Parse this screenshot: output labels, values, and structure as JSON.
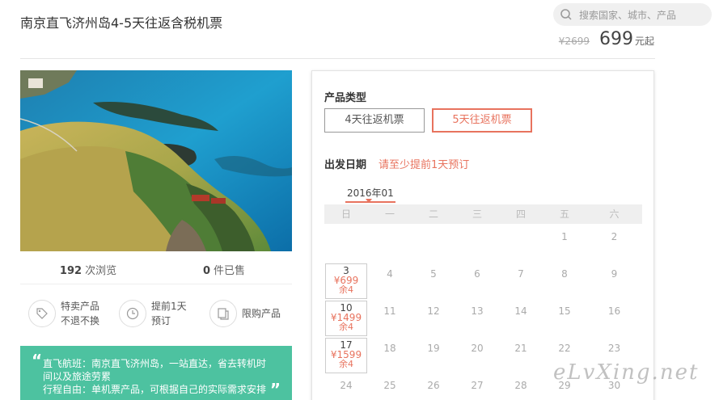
{
  "header": {
    "title": "南京直飞济州岛4-5天往返含税机票",
    "search_placeholder": "搜索国家、城市、产品",
    "old_price": "¥2699",
    "price": "699",
    "price_unit": "元起"
  },
  "stats": {
    "views_count": "192",
    "views_label": "次浏览",
    "sold_count": "0",
    "sold_label": "件已售"
  },
  "features": [
    {
      "icon": "tag-icon",
      "line1": "特卖产品",
      "line2": "不退不换"
    },
    {
      "icon": "clock-icon",
      "line1": "提前1天",
      "line2": "预订"
    },
    {
      "icon": "copy-icon",
      "line1": "限购产品",
      "line2": ""
    }
  ],
  "promo": {
    "open_quote": "“",
    "close_quote": "”",
    "line1": "直飞航班：南京直飞济州岛，一站直达，省去转机时",
    "line2": "间以及旅途劳累",
    "line3": "行程自由：单机票产品，可根据自己的实际需求安排"
  },
  "booking": {
    "product_type_label": "产品类型",
    "options": [
      {
        "label": "4天往返机票",
        "selected": false
      },
      {
        "label": "5天往返机票",
        "selected": true
      }
    ],
    "date_label": "出发日期",
    "date_note": "请至少提前1天预订",
    "month": "2016年01",
    "weekdays": [
      "日",
      "一",
      "二",
      "三",
      "四",
      "五",
      "六"
    ],
    "calendar_rows": [
      [
        null,
        null,
        null,
        null,
        null,
        {
          "day": "1"
        },
        {
          "day": "2"
        }
      ],
      [
        {
          "day": "3",
          "price": "¥699",
          "stock": "余4"
        },
        {
          "day": "4"
        },
        {
          "day": "5"
        },
        {
          "day": "6"
        },
        {
          "day": "7"
        },
        {
          "day": "8"
        },
        {
          "day": "9"
        }
      ],
      [
        {
          "day": "10",
          "price": "¥1499",
          "stock": "余4"
        },
        {
          "day": "11"
        },
        {
          "day": "12"
        },
        {
          "day": "13"
        },
        {
          "day": "14"
        },
        {
          "day": "15"
        },
        {
          "day": "16"
        }
      ],
      [
        {
          "day": "17",
          "price": "¥1599",
          "stock": "余4"
        },
        {
          "day": "18"
        },
        {
          "day": "19"
        },
        {
          "day": "20"
        },
        {
          "day": "21"
        },
        {
          "day": "22"
        },
        {
          "day": "23"
        }
      ],
      [
        {
          "day": "24"
        },
        {
          "day": "25"
        },
        {
          "day": "26"
        },
        {
          "day": "27"
        },
        {
          "day": "28"
        },
        {
          "day": "29"
        },
        {
          "day": "30"
        }
      ]
    ]
  },
  "watermark": "eLvXing.net",
  "colors": {
    "accent": "#e8735e",
    "promo_bg": "#4dc2a0"
  }
}
